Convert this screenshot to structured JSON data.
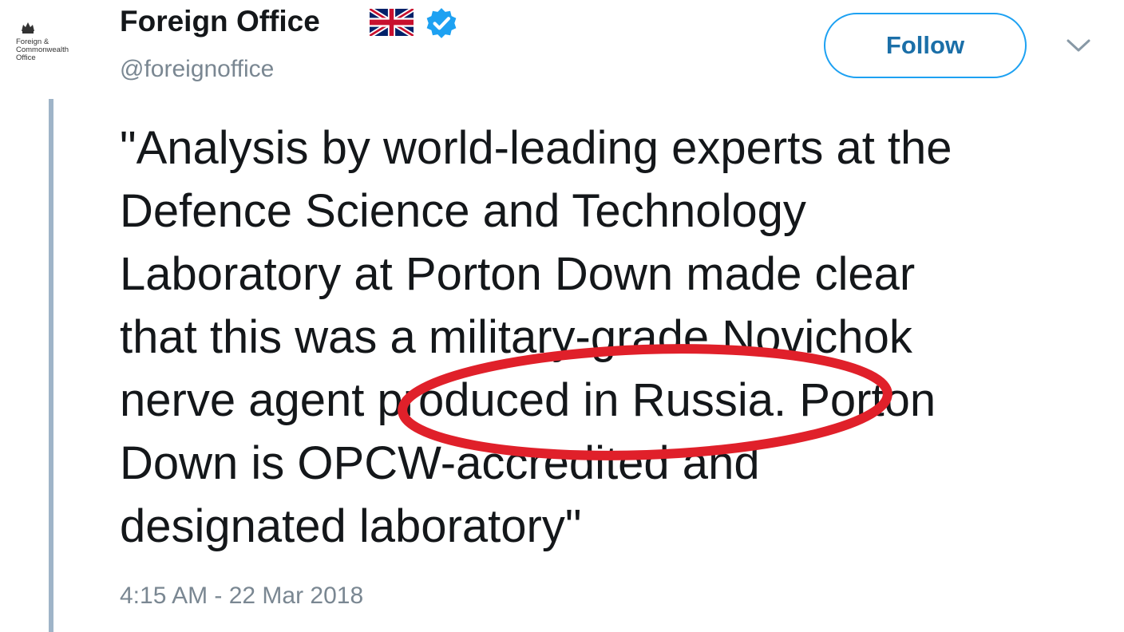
{
  "account": {
    "avatar_logo_text": "Foreign &\nCommonwealth\nOffice",
    "display_name": "Foreign Office",
    "handle": "@foreignoffice",
    "flag_icon": "uk-flag-icon",
    "verified_icon": "verified-badge-icon"
  },
  "actions": {
    "follow_label": "Follow",
    "menu_icon": "chevron-down-icon"
  },
  "tweet": {
    "lines": [
      "\"Analysis by world-leading experts at the",
      "Defence Science and Technology",
      "Laboratory at Porton Down made clear",
      "that this was a military-grade Novichok",
      "nerve agent produced in Russia. Porton",
      "Down is OPCW-accredited and",
      "designated laboratory\""
    ],
    "timestamp": "4:15 AM - 22 Mar 2018"
  },
  "annotation": {
    "highlight_color": "#e0202a"
  },
  "colors": {
    "text": "#14171a",
    "muted": "#7a8792",
    "accent": "#1da1f2",
    "thread_line": "#9fb4c8"
  }
}
